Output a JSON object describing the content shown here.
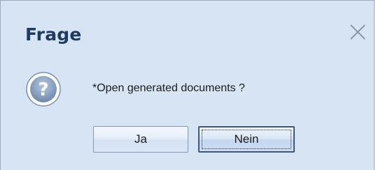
{
  "dialog": {
    "title": "Frage",
    "message": "*Open generated documents ?",
    "icons": {
      "close": "close-icon",
      "question": "question-icon"
    },
    "buttons": {
      "yes_label": "Ja",
      "no_label": "Nein",
      "default": "no"
    },
    "colors": {
      "background": "#d6e4f3",
      "title_text": "#1f3b63",
      "icon_fill": "#7f97b8"
    }
  }
}
